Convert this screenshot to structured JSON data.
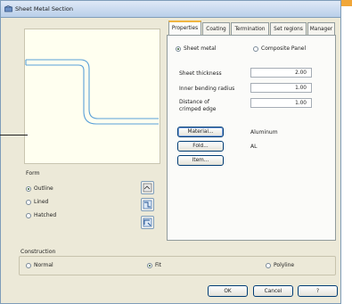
{
  "window": {
    "title": "Sheet Metal Section"
  },
  "tabs": [
    {
      "label": "Properties"
    },
    {
      "label": "Coating"
    },
    {
      "label": "Termination"
    },
    {
      "label": "Set regions"
    },
    {
      "label": "Manager"
    }
  ],
  "properties": {
    "type_options": [
      {
        "label": "Sheet metal",
        "selected": true
      },
      {
        "label": "Composite Panel",
        "selected": false
      }
    ],
    "fields": [
      {
        "label": "Sheet thickness",
        "value": "2.00"
      },
      {
        "label": "Inner bending radius",
        "value": "1.00"
      },
      {
        "label": "Distance of crimped edge",
        "value": "1.00"
      }
    ],
    "material_button": "Material...",
    "material_value": "Aluminum",
    "fold_button": "Fold...",
    "fold_value": "AL",
    "item_button": "Item..."
  },
  "form": {
    "title": "Form",
    "options": [
      {
        "label": "Outline",
        "selected": true
      },
      {
        "label": "Lined",
        "selected": false
      },
      {
        "label": "Hatched",
        "selected": false
      }
    ]
  },
  "construction": {
    "title": "Construction",
    "options": [
      {
        "label": "Normal",
        "selected": false
      },
      {
        "label": "Fit",
        "selected": true
      },
      {
        "label": "Polyline",
        "selected": false
      }
    ]
  },
  "buttons": {
    "ok": "OK",
    "cancel": "Cancel",
    "help": "?"
  },
  "colors": {
    "accent": "#f0a638",
    "profile": "#5aa0d8",
    "preview_bg": "#fffff0"
  }
}
